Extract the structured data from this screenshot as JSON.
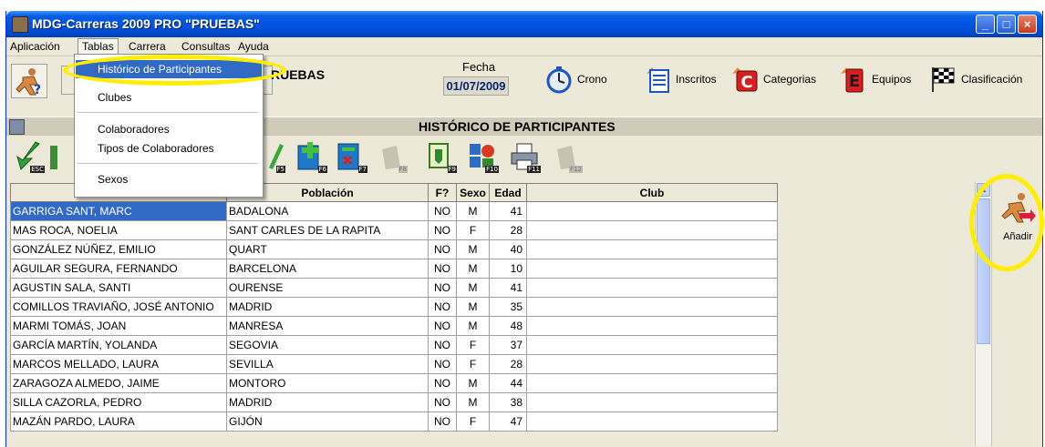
{
  "window": {
    "title": "MDG-Carreras 2009 PRO \"PRUEBAS\"",
    "minimize": "_",
    "maximize": "□",
    "close": "×"
  },
  "menubar": [
    "Aplicación",
    "Tablas",
    "Carrera",
    "Consultas",
    "Ayuda"
  ],
  "tablas_menu": [
    {
      "label": "Histórico de Participantes",
      "highlighted": true
    },
    {
      "label": "Clubes"
    },
    {
      "label": "Colaboradores"
    },
    {
      "label": "Tipos de Colaboradores"
    },
    {
      "label": "Sexos"
    }
  ],
  "infobar": {
    "event_name": "RUEBAS",
    "fecha_label": "Fecha",
    "fecha_value": "01/07/2009",
    "nav": [
      {
        "label": "Crono",
        "icon": "stopwatch-icon"
      },
      {
        "label": "Inscritos",
        "icon": "list-icon"
      },
      {
        "label": "Categorias",
        "icon": "category-c-icon"
      },
      {
        "label": "Equipos",
        "icon": "team-e-icon"
      },
      {
        "label": "Clasificación",
        "icon": "checkered-flag-icon"
      }
    ]
  },
  "section_title": "HISTÓRICO DE PARTICIPANTES",
  "toolbar": {
    "keys": [
      "ESC",
      "F5",
      "F6",
      "F7",
      "F8",
      "F9",
      "F10",
      "F11",
      "F12"
    ]
  },
  "table": {
    "headers": {
      "poblacion": "Población",
      "federado": "F?",
      "sexo": "Sexo",
      "edad": "Edad",
      "club": "Club"
    },
    "rows": [
      {
        "nombre": "GARRIGA SANT, MARC",
        "poblacion": "BADALONA",
        "federado": "NO",
        "sexo": "M",
        "edad": "41",
        "club": ""
      },
      {
        "nombre": "MAS ROCA, NOELIA",
        "poblacion": "SANT CARLES DE LA RAPITA",
        "federado": "NO",
        "sexo": "F",
        "edad": "28",
        "club": ""
      },
      {
        "nombre": "GONZÁLEZ NÚÑEZ, EMILIO",
        "poblacion": "QUART",
        "federado": "NO",
        "sexo": "M",
        "edad": "40",
        "club": ""
      },
      {
        "nombre": "AGUILAR SEGURA, FERNANDO",
        "poblacion": "BARCELONA",
        "federado": "NO",
        "sexo": "M",
        "edad": "10",
        "club": ""
      },
      {
        "nombre": "AGUSTIN SALA, SANTI",
        "poblacion": "OURENSE",
        "federado": "NO",
        "sexo": "M",
        "edad": "41",
        "club": ""
      },
      {
        "nombre": "COMILLOS TRAVIAÑO, JOSÉ ANTONIO",
        "poblacion": "MADRID",
        "federado": "NO",
        "sexo": "M",
        "edad": "35",
        "club": ""
      },
      {
        "nombre": "MARMI TOMÁS, JOAN",
        "poblacion": "MANRESA",
        "federado": "NO",
        "sexo": "M",
        "edad": "48",
        "club": ""
      },
      {
        "nombre": "GARCÍA MARTÍN, YOLANDA",
        "poblacion": "SEGOVIA",
        "federado": "NO",
        "sexo": "F",
        "edad": "37",
        "club": ""
      },
      {
        "nombre": "MARCOS MELLADO, LAURA",
        "poblacion": "SEVILLA",
        "federado": "NO",
        "sexo": "F",
        "edad": "28",
        "club": ""
      },
      {
        "nombre": "ZARAGOZA ALMEDO, JAIME",
        "poblacion": "MONTORO",
        "federado": "NO",
        "sexo": "M",
        "edad": "44",
        "club": ""
      },
      {
        "nombre": "SILLA CAZORLA, PEDRO",
        "poblacion": "MADRID",
        "federado": "NO",
        "sexo": "M",
        "edad": "38",
        "club": ""
      },
      {
        "nombre": "MAZÁN PARDO, LAURA",
        "poblacion": "GIJÓN",
        "federado": "NO",
        "sexo": "F",
        "edad": "47",
        "club": ""
      }
    ]
  },
  "side": {
    "add_label": "Añadir"
  },
  "colors": {
    "titlebar": "#0054e3",
    "selection": "#316ac5",
    "highlight_ring": "#ffee00",
    "face": "#ece9d8"
  }
}
